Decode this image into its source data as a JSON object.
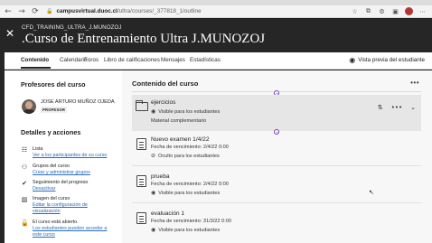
{
  "browser": {
    "url_host": "campusvirtual.duoc.cl",
    "url_path": "/ultra/courses/_377818_1/outline",
    "nav": {
      "back": "←",
      "forward": "→",
      "reload": "⟳"
    },
    "lock_icon": "lock-icon",
    "toolbar_icons": [
      "star-icon",
      "extensions-icon",
      "settings-icon",
      "collections-icon",
      "profile-avatar",
      "menu-icon"
    ]
  },
  "course": {
    "id": "CFD_TRAINING_ULTRA_J.MUNOZOJ",
    "title": ".Curso de Entrenamiento Ultra J.MUNOZOJ",
    "close_glyph": "✕"
  },
  "tabs": [
    {
      "label": "Contenido",
      "active": true
    },
    {
      "label": "Calendario"
    },
    {
      "label": "Foros"
    },
    {
      "label": "Libro de calificaciones"
    },
    {
      "label": "Mensajes"
    },
    {
      "label": "Estadísticas"
    }
  ],
  "preview_label": "Vista previa del estudiante",
  "left": {
    "teachers_heading": "Profesores del curso",
    "teacher_name": "JOSE ARTURO MUÑOZ OJEDA",
    "teacher_role": "PROFESOR",
    "details_heading": "Detalles y acciones",
    "details": [
      {
        "title": "Lista",
        "link": "Ver a los participantes de su curso",
        "icon": "roster-icon"
      },
      {
        "title": "Grupos del curso",
        "link": "Crear y administrar grupos",
        "icon": "groups-icon"
      },
      {
        "title": "Seguimiento del progreso",
        "link": "Desactivar",
        "icon": "progress-icon"
      },
      {
        "title": "Imagen del curso",
        "link": "Editar la configuración de",
        "link2": "visualización",
        "icon": "image-icon"
      },
      {
        "title": "El curso está abierto.",
        "link": "Los estudiantes pueden acceder a",
        "link2": "este curso",
        "icon": "lock-open-icon"
      }
    ]
  },
  "content": {
    "heading": "Contenido del curso",
    "more": "•••",
    "items": [
      {
        "name": "ejercicios",
        "status": "Visible para los estudiantes",
        "extra": "Material complementario",
        "type": "folder"
      },
      {
        "name": "Nuevo examen 1/4/22",
        "due": "Fecha de vencimiento: 2/4/22 0:00",
        "status": "Oculto para los estudiantes",
        "type": "test"
      },
      {
        "name": "prueba",
        "due": "Fecha de vencimiento: 2/4/22 0:00",
        "status": "Visible para los estudiantes",
        "type": "test"
      },
      {
        "name": "evaluación 1",
        "due": "Fecha de vencimiento: 31/3/22 0:00",
        "status": "Visible para los estudiantes",
        "type": "test"
      }
    ],
    "actions": {
      "reorder": "⇅",
      "more": "•••",
      "expand": "⌄"
    }
  }
}
